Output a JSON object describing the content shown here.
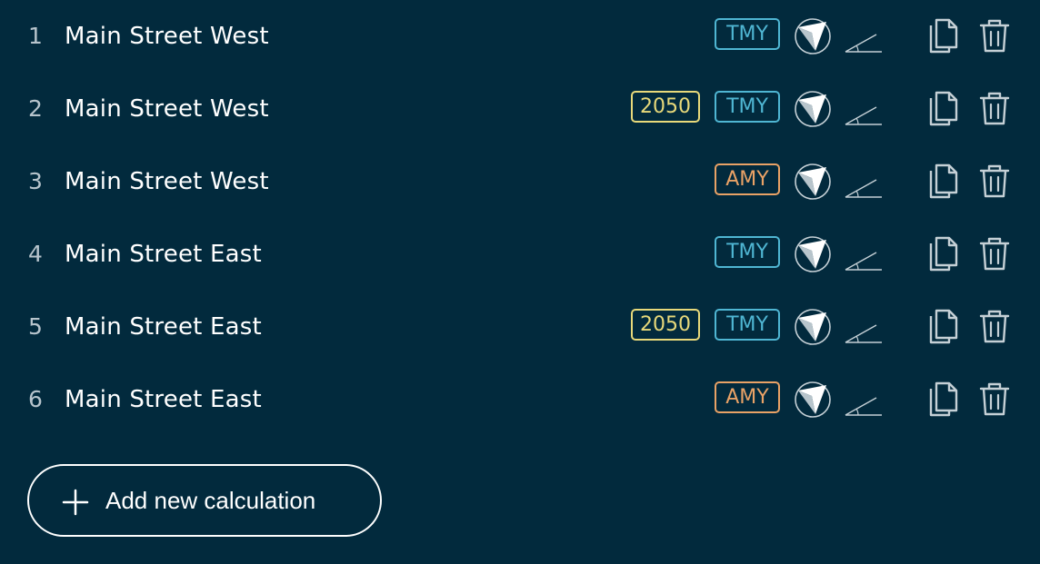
{
  "colors": {
    "background": "#022a3d",
    "tmy": "#4fb6d3",
    "amy": "#e9a266",
    "year": "#e8d97a",
    "icon": "#c5d0d6"
  },
  "icons": {
    "orientation": "compass-arrow-icon",
    "tilt": "tilt-angle-icon",
    "duplicate": "copy-icon",
    "delete": "trash-icon",
    "add": "plus-icon"
  },
  "calculations": [
    {
      "index": "1",
      "name": "Main Street West",
      "year": "",
      "dataset": "TMY"
    },
    {
      "index": "2",
      "name": "Main Street West",
      "year": "2050",
      "dataset": "TMY"
    },
    {
      "index": "3",
      "name": "Main Street West",
      "year": "",
      "dataset": "AMY"
    },
    {
      "index": "4",
      "name": "Main Street East",
      "year": "",
      "dataset": "TMY"
    },
    {
      "index": "5",
      "name": "Main Street East",
      "year": "2050",
      "dataset": "TMY"
    },
    {
      "index": "6",
      "name": "Main Street East",
      "year": "",
      "dataset": "AMY"
    }
  ],
  "add_button": {
    "label": "Add new calculation"
  }
}
